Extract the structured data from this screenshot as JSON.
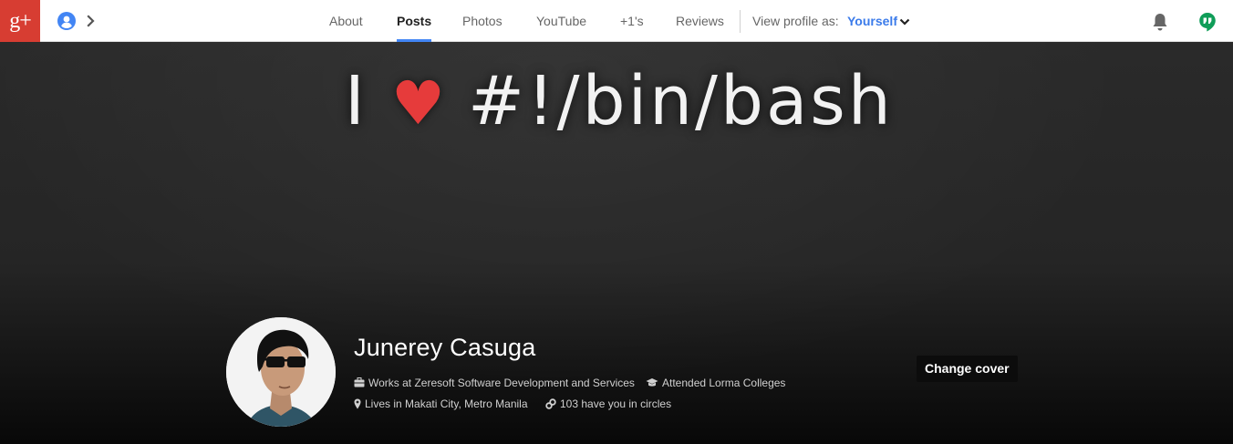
{
  "app": {
    "logo_text": "g+"
  },
  "nav": {
    "tabs": [
      {
        "label": "About"
      },
      {
        "label": "Posts",
        "active": true
      },
      {
        "label": "Photos"
      },
      {
        "label": "YouTube"
      },
      {
        "label": "+1's"
      },
      {
        "label": "Reviews"
      }
    ],
    "view_profile_label": "View profile as:",
    "view_profile_value": "Yourself"
  },
  "icons": {
    "logo": "google-plus-logo",
    "profile_switch": "account-icon",
    "expand": "chevron-right-icon",
    "notifications": "bell-icon",
    "hangouts": "hangouts-icon"
  },
  "colors": {
    "brand_red": "#d73d32",
    "accent_blue": "#4285f4",
    "link_blue": "#3b7bea",
    "hangouts_green": "#0f9d58",
    "heart_red": "#e63b3b"
  },
  "cover": {
    "slogan_prefix": "I",
    "slogan_heart": "♥",
    "slogan_suffix": "#!/bin/bash"
  },
  "profile": {
    "name": "Junerey Casuga",
    "work": "Works at Zeresoft Software Development and Services",
    "education": "Attended Lorma Colleges",
    "location": "Lives in Makati City, Metro Manila",
    "circles": "103 have you in circles"
  },
  "actions": {
    "change_cover": "Change cover"
  }
}
